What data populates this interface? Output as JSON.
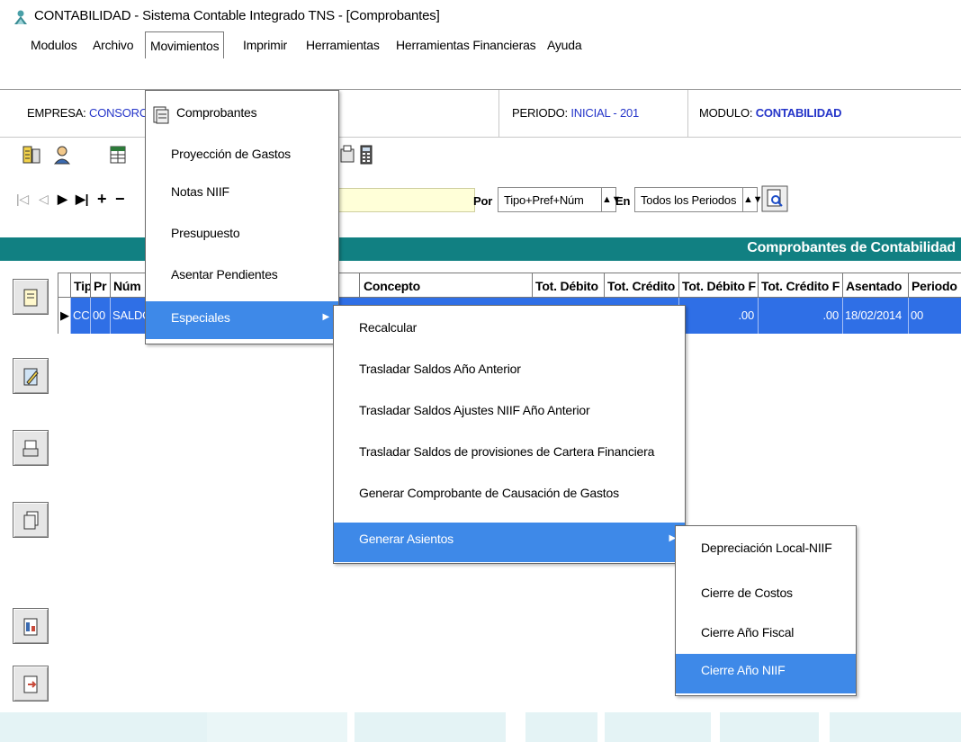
{
  "window": {
    "title": "CONTABILIDAD - Sistema Contable Integrado TNS - [Comprobantes]"
  },
  "menubar": {
    "items": [
      "Modulos",
      "Archivo",
      "Movimientos",
      "Imprimir",
      "Herramientas",
      "Herramientas Financieras",
      "Ayuda"
    ]
  },
  "info": {
    "empresa_label": "EMPRESA:",
    "empresa_value": "CONSORCI",
    "periodo_label": "PERIODO:",
    "periodo_value": "INICIAL - 201",
    "modulo_label": "MODULO:",
    "modulo_value": "CONTABILIDAD"
  },
  "navigator": {
    "glyphs": [
      "|◁",
      "◁",
      "▶",
      "▶|",
      "+",
      "−"
    ],
    "por_label": "Por",
    "por_value": "Tipo+Pref+Núm",
    "en_label": "En",
    "en_value": "Todos los Periodos"
  },
  "grid": {
    "caption": "Comprobantes de Contabilidad",
    "columns": [
      "Tip",
      "Pr",
      "Núm",
      "Concepto",
      "Tot. Débito",
      "Tot. Crédito",
      "Tot. Débito F",
      "Tot. Crédito F",
      "Asentado",
      "Periodo"
    ],
    "row": {
      "indicator": "▶",
      "tip": "CC",
      "pr": "00",
      "num": "SALDO",
      "tot_debito_f": ".00",
      "tot_credito_f": ".00",
      "asentado": "18/02/2014",
      "periodo": "00"
    }
  },
  "menu_movimientos": {
    "items": [
      "Comprobantes",
      "Proyección de Gastos",
      "Notas NIIF",
      "Presupuesto",
      "Asentar Pendientes",
      "Especiales"
    ]
  },
  "menu_especiales": {
    "items": [
      "Recalcular",
      "Trasladar Saldos Año Anterior",
      "Trasladar Saldos Ajustes NIIF Año Anterior",
      "Trasladar Saldos de provisiones de Cartera Financiera",
      "Generar Comprobante de Causación de Gastos",
      "Generar Asientos"
    ]
  },
  "menu_generar_asientos": {
    "items": [
      "Depreciación Local-NIIF",
      "Cierre de Costos",
      "Cierre Año Fiscal",
      "Cierre Año NIIF"
    ]
  },
  "colors": {
    "teal": "#118082",
    "selection": "#3e89e8",
    "grid_selection": "#2f6fe6",
    "info_blue": "#2535c9"
  }
}
